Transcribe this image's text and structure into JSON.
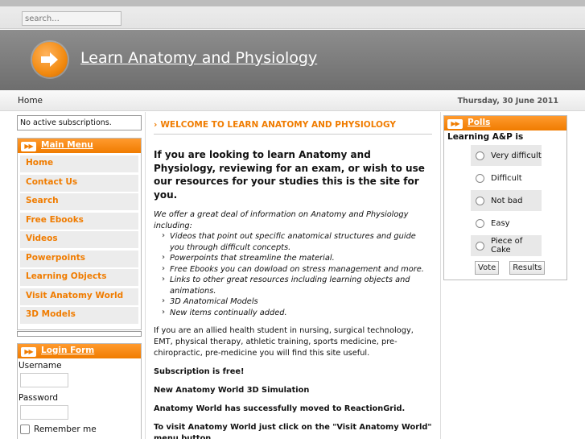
{
  "search": {
    "placeholder": "search..."
  },
  "header": {
    "title": "Learn Anatomy and Physiology"
  },
  "breadcrumb": {
    "home": "Home",
    "date": "Thursday, 30 June 2011"
  },
  "left": {
    "subscriptions": "No active subscriptions.",
    "main_menu": {
      "title": "Main Menu",
      "items": [
        "Home",
        "Contact Us",
        "Search",
        "Free Ebooks",
        "Videos",
        "Powerpoints",
        "Learning Objects",
        "Visit Anatomy World",
        "3D Models"
      ]
    },
    "login": {
      "title": "Login Form",
      "username_label": "Username",
      "password_label": "Password",
      "remember_label": "Remember me"
    }
  },
  "content": {
    "title": "WELCOME TO LEARN ANATOMY AND PHYSIOLOGY",
    "intro": "If you are looking to learn Anatomy and Physiology, reviewing for an exam, or wish to use our resources for your studies this is the site for you.",
    "offer": "We offer a great deal of information on Anatomy and Physiology including:",
    "bullets": [
      "Videos that point out specific anatomical structures and guide you through difficult concepts.",
      "Powerpoints that streamline the material.",
      "Free Ebooks you can dowload on stress management and more.",
      "Links to other great resources including learning objects and animations.",
      "3D Anatomical Models",
      "New items continually added."
    ],
    "para1": "If you are an allied health student in nursing, surgical technology, EMT, physical therapy, athletic training, sports medicine, pre-chiropractic, pre-medicine you will find this site useful.",
    "para2": "Subscription is free!",
    "para3": "New Anatomy World 3D Simulation",
    "para4": "Anatomy World has successfully moved to ReactionGrid.",
    "para5": "To visit Anatomy World just click on the \"Visit Anatomy World\" menu button."
  },
  "polls": {
    "title": "Polls",
    "question": "Learning A&P is",
    "options": [
      "Very difficult",
      "Difficult",
      "Not bad",
      "Easy",
      "Piece of Cake"
    ],
    "vote_label": "Vote",
    "results_label": "Results"
  },
  "colors": {
    "accent": "#f07c00",
    "header_bg": "#7d7d7d"
  },
  "icons": {
    "logo": "orange-arrow-circle-icon",
    "module_header": "double-chevron-icon",
    "title_marker": "chevron-right-icon"
  }
}
